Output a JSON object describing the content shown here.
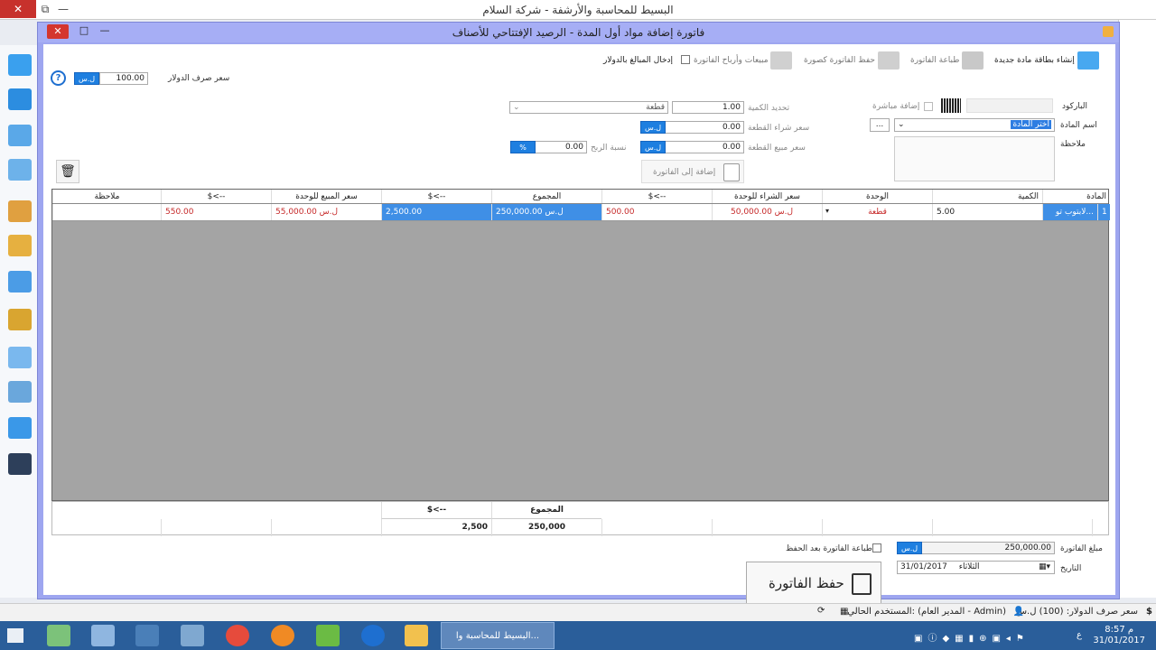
{
  "outer_window": {
    "title": "البسيط للمحاسبة والأرشفة - شركة السلام",
    "close_glyph": "✕",
    "restore_glyph": "⧉",
    "min_glyph": "—"
  },
  "dialog": {
    "title": "فاتورة إضافة مواد أول المدة - الرصيد الإفتتاحي للأصناف",
    "close_glyph": "✕",
    "max_glyph": "□",
    "min_glyph": "—"
  },
  "toolbar": {
    "new_item_card": "إنشاء بطاقة مادة جديدة",
    "print_invoice": "طباعة الفاتورة",
    "save_as_image": "حفظ الفاتورة كصورة",
    "sales_profits": "مبيعات وأرباح الفاتورة",
    "enter_in_dollar": "إدخال المبالغ بالدولار",
    "dollar_rate_label": "سعر صرف الدولار",
    "dollar_rate_value": "100.00",
    "currency": "ل.س",
    "help_glyph": "?"
  },
  "form": {
    "barcode_label": "الباركود",
    "direct_add_label": "إضافة مباشرة",
    "item_name_label": "اسم المادة",
    "item_name_value": "اختر المادة",
    "browse_btn": "...",
    "note_label": "ملاحظة",
    "qty_label": "تحديد الكمية",
    "qty_value": "1.00",
    "unit_value": "قطعة",
    "buy_price_label": "سعر شراء القطعة",
    "buy_price_value": "0.00",
    "sell_price_label": "سعر مبيع القطعة",
    "sell_price_value": "0.00",
    "profit_label": "نسبة الربح",
    "profit_value": "0.00",
    "percent": "%",
    "add_to_invoice": "إضافة إلى الفاتورة",
    "currency": "ل.س"
  },
  "grid": {
    "headers": {
      "item": "المادة",
      "qty": "الكمية",
      "unit": "الوحدة",
      "buy_price": "سعر الشراء للوحدة",
      "buy_usd": "$<--",
      "total": "المجموع",
      "total_usd": "$<--",
      "sell_price": "سعر المبيع للوحدة",
      "sell_usd": "$<--",
      "note": "ملاحظة"
    },
    "row": {
      "index": "1",
      "item": "لابتوب تو...",
      "qty": "5.00",
      "unit": "قطعة",
      "buy_price": "50,000.00 ل.س",
      "buy_usd": "500.00",
      "total": "250,000.00 ل.س",
      "total_usd": "2,500.00",
      "sell_price": "55,000.00 ل.س",
      "sell_usd": "550.00",
      "note": ""
    }
  },
  "totals": {
    "total_label": "المجموع",
    "total_usd_label": "$<--",
    "total_value": "250,000",
    "total_usd_value": "2,500"
  },
  "footer": {
    "invoice_amount_label": "مبلغ الفاتورة",
    "invoice_amount_value": "250,000.00",
    "currency": "ل.س",
    "print_after_save": "طباعة الفاتورة بعد الحفظ",
    "date_label": "التاريخ",
    "date_value": "31/01/2017",
    "day_value": "الثلاثاء",
    "save_invoice": "حفظ الفاتورة"
  },
  "statusbar": {
    "dollar_rate": "سعر صرف الدولار: (100) ل.س",
    "current_user": "المستخدم الحالي: (المدير العام - Admin)"
  },
  "taskbar": {
    "active_app": "البسيط للمحاسبة وا...",
    "time": "8:57 م",
    "date": "31/01/2017",
    "lang": "ع"
  },
  "colors": {
    "dialog_border": "#9ea6f0",
    "accent_blue": "#1e7fe0",
    "selected_cell": "#3f8fe6",
    "price_red": "#c62828",
    "grid_empty": "#a4a4a4",
    "taskbar": "#2a5e9a"
  }
}
